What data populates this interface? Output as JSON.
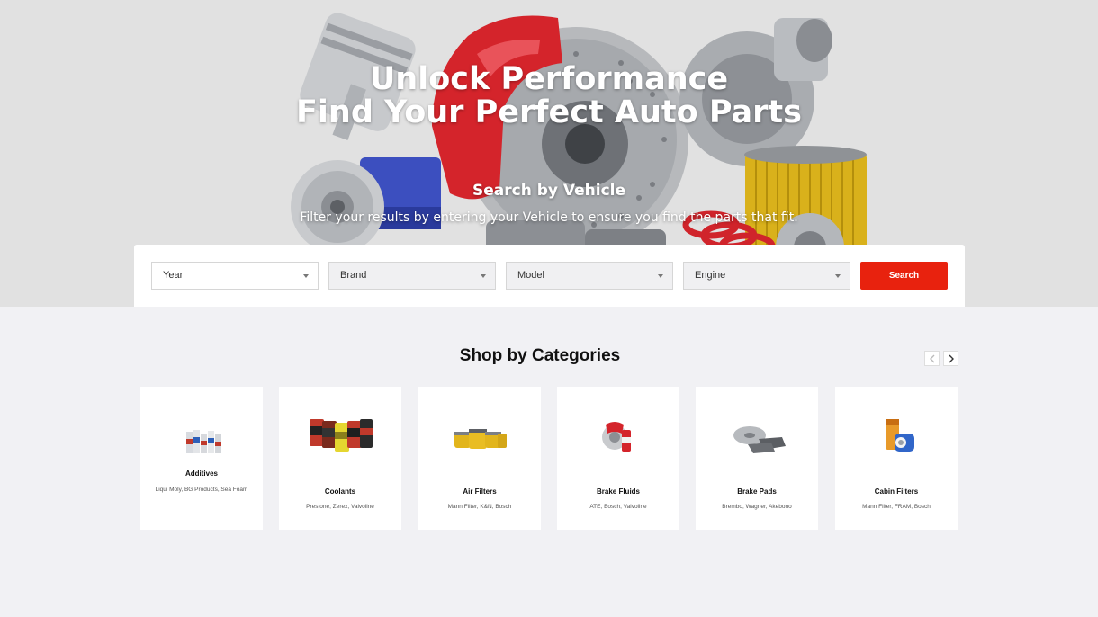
{
  "hero": {
    "title_line1": "Unlock Performance",
    "title_line2": "Find Your Perfect Auto Parts",
    "subtitle": "Search by Vehicle",
    "description": "Filter your results by entering your Vehicle to ensure you find the parts that fit."
  },
  "search": {
    "filters": [
      {
        "label": "Year"
      },
      {
        "label": "Brand"
      },
      {
        "label": "Model"
      },
      {
        "label": "Engine"
      }
    ],
    "button_label": "Search",
    "accent_color": "#e8220e"
  },
  "categories": {
    "heading": "Shop by Categories",
    "prev_icon": "chevron-left-icon",
    "next_icon": "chevron-right-icon",
    "items": [
      {
        "name": "Additives",
        "brands": "Liqui Moly, BG Products, Sea Foam",
        "icon": "additive-bottles-image"
      },
      {
        "name": "Coolants",
        "brands": "Prestone, Zerex, Valvoline",
        "icon": "coolant-jugs-image"
      },
      {
        "name": "Air Filters",
        "brands": "Mann Filter, K&N, Bosch",
        "icon": "air-filters-image"
      },
      {
        "name": "Brake Fluids",
        "brands": "ATE, Bosch, Valvoline",
        "icon": "brake-fluid-image"
      },
      {
        "name": "Brake Pads",
        "brands": "Brembo, Wagner, Akebono",
        "icon": "brake-pads-image"
      },
      {
        "name": "Cabin Filters",
        "brands": "Mann Filter, FRAM, Bosch",
        "icon": "cabin-filter-image"
      }
    ]
  }
}
